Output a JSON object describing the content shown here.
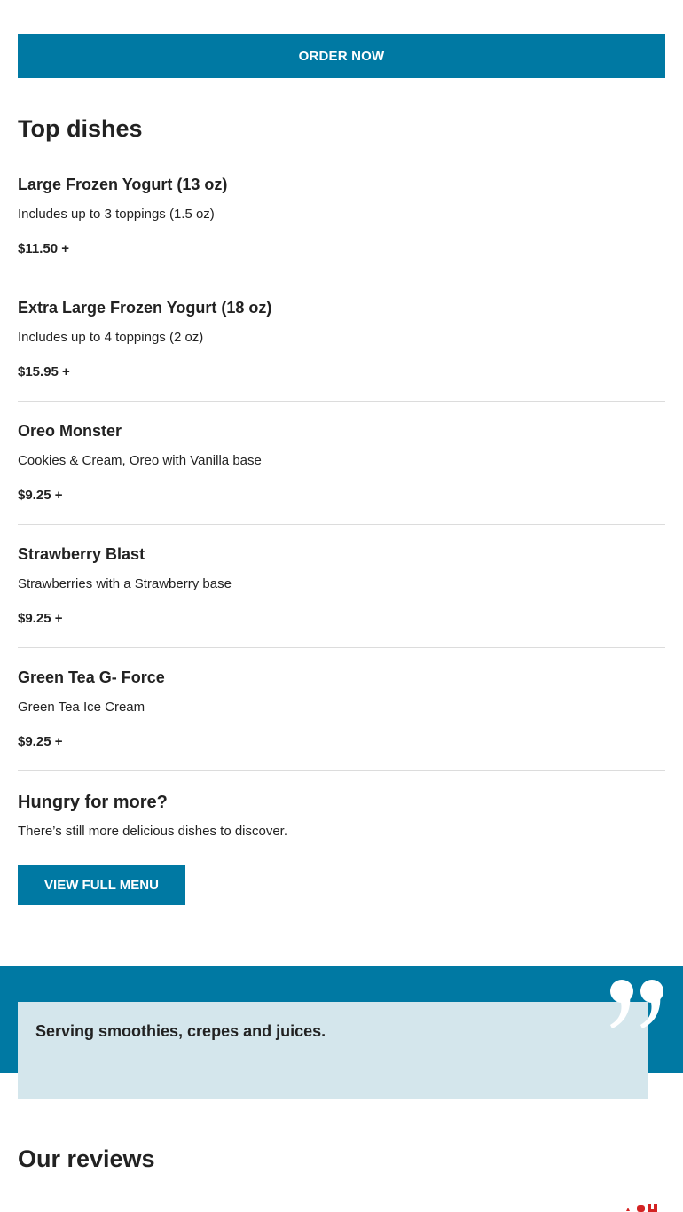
{
  "order_button": {
    "label": "ORDER NOW"
  },
  "top_dishes": {
    "title": "Top dishes",
    "items": [
      {
        "name": "Large Frozen Yogurt (13 oz)",
        "description": "Includes up to 3 toppings (1.5 oz)",
        "price": "$11.50 +"
      },
      {
        "name": "Extra Large Frozen Yogurt (18 oz)",
        "description": "Includes up to 4 toppings (2 oz)",
        "price": "$15.95 +"
      },
      {
        "name": "Oreo Monster",
        "description": "Cookies & Cream, Oreo with Vanilla base",
        "price": "$9.25 +"
      },
      {
        "name": "Strawberry Blast",
        "description": "Strawberries with a Strawberry base",
        "price": "$9.25 +"
      },
      {
        "name": "Green Tea G- Force",
        "description": "Green Tea Ice Cream",
        "price": "$9.25 +"
      }
    ]
  },
  "more": {
    "title": "Hungry for more?",
    "text": "There’s still more delicious dishes to discover.",
    "button_label": "VIEW FULL MENU"
  },
  "quote": {
    "text": "Serving smoothies, crepes and juices."
  },
  "reviews": {
    "title": "Our reviews"
  },
  "colors": {
    "accent": "#0079a3",
    "quote_card": "#d4e6ec",
    "brand_red": "#d32323"
  },
  "icons": {
    "quote": "quote-icon",
    "brand": "brand-logo-icon"
  }
}
